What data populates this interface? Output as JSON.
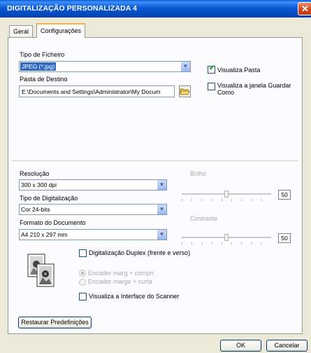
{
  "window": {
    "title": "DIGITALIZAÇÃO PERSONALIZADA 4"
  },
  "tabs": [
    {
      "label": "Geral"
    },
    {
      "label": "Configurações"
    }
  ],
  "file_type": {
    "label": "Tipo de Ficheiro",
    "value": "JPEG (*.jpg)"
  },
  "destination": {
    "label": "Pasta de Destino",
    "value": "E:\\Documents and Settings\\Administrator\\My Docum"
  },
  "options": {
    "show_folder": {
      "label": "Visualiza Pasta",
      "checked": true
    },
    "show_save_window": {
      "label_line1": "Visualiza a janela Guardar",
      "label_line2": "Como",
      "checked": false
    }
  },
  "resolution": {
    "label": "Resolução",
    "value": "300 x 300 dpi"
  },
  "scan_type": {
    "label": "Tipo de Digitalização",
    "value": "Cor 24-bits"
  },
  "document_size": {
    "label": "Formato do Documento",
    "value": "A4 210 x 297 mm"
  },
  "brightness": {
    "label": "Brilho",
    "value": "50"
  },
  "contrast": {
    "label": "Contraste",
    "value": "50"
  },
  "duplex": {
    "label": "Digitalização Duplex (frente e verso)",
    "checked": false
  },
  "binding": [
    {
      "label": "Encader marg + compri",
      "selected": true
    },
    {
      "label": "Encader marge + curta",
      "selected": false
    }
  ],
  "scanner_ui": {
    "label": "Visualiza a Interface do Scanner",
    "checked": false
  },
  "buttons": {
    "restore": "Restaurar Predefinições",
    "ok": "OK",
    "cancel": "Cancelar"
  },
  "icons": {
    "close": "close-icon",
    "folder": "folder-icon",
    "dropdown": "chevron-down-icon"
  }
}
